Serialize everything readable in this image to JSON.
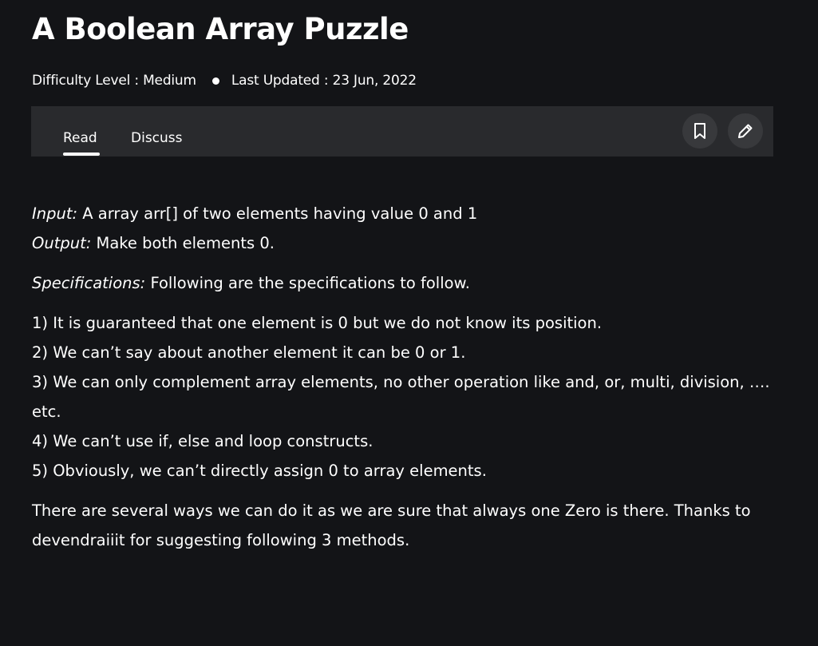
{
  "article": {
    "title": "A Boolean Array Puzzle",
    "difficulty": "Difficulty Level : Medium",
    "last_updated": "Last Updated : 23 Jun, 2022"
  },
  "tabs": {
    "read": "Read",
    "discuss": "Discuss"
  },
  "actions": {
    "bookmark_icon": "bookmark-icon",
    "edit_icon": "pencil-icon"
  },
  "content": {
    "input_label": "Input:",
    "input_text": " A array arr[] of two elements having value 0 and 1",
    "output_label": "Output:",
    "output_text": " Make both elements 0.",
    "spec_label": "Specifications:",
    "spec_text": " Following are the specifications to follow.",
    "rules": [
      "1) It is guaranteed that one element is 0 but we do not know its position.",
      "2) We can’t say about another element it can be 0 or 1.",
      "3) We can only complement array elements, no other operation like and, or, multi, division, …. etc.",
      "4) We can’t use if, else and loop constructs.",
      "5) Obviously, we can’t directly assign 0 to array elements."
    ],
    "closing": "There are several ways we can do it as we are sure that always one Zero is there. Thanks to devendraiiit for suggesting following 3 methods."
  }
}
